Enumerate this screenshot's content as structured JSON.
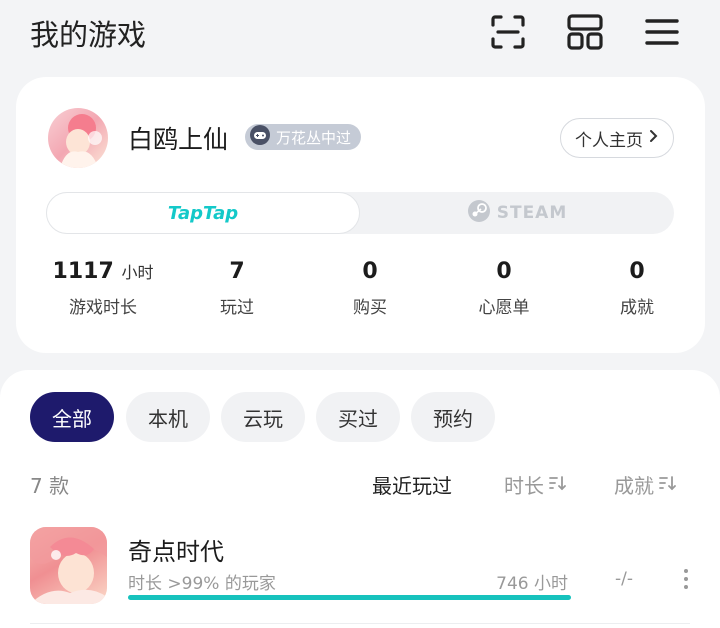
{
  "header": {
    "title": "我的游戏",
    "icons": [
      "scan-icon",
      "grid-layout-icon",
      "menu-icon"
    ]
  },
  "profile": {
    "name": "白鸥上仙",
    "badge": "万花丛中过",
    "homepage_label": "个人主页",
    "platforms": {
      "taptap": "TapTap",
      "steam": "STEAM",
      "active": "taptap"
    },
    "stats": [
      {
        "value": "1117",
        "unit": "小时",
        "label": "游戏时长"
      },
      {
        "value": "7",
        "unit": "",
        "label": "玩过"
      },
      {
        "value": "0",
        "unit": "",
        "label": "购买"
      },
      {
        "value": "0",
        "unit": "",
        "label": "心愿单"
      },
      {
        "value": "0",
        "unit": "",
        "label": "成就"
      }
    ]
  },
  "filters": {
    "items": [
      "全部",
      "本机",
      "云玩",
      "买过",
      "预约"
    ],
    "active": "全部"
  },
  "list": {
    "count_label": "7 款",
    "sort": {
      "recent": "最近玩过",
      "duration": "时长",
      "achievement": "成就"
    },
    "games": [
      {
        "name": "奇点时代",
        "subtitle": "时长 >99% 的玩家",
        "hours": "746 小时",
        "achievement": "-/-",
        "progress": 1.0
      }
    ]
  },
  "colors": {
    "accent": "#14c9c9",
    "chip_active": "#1e1a6c",
    "progress": "#16c2bd"
  }
}
